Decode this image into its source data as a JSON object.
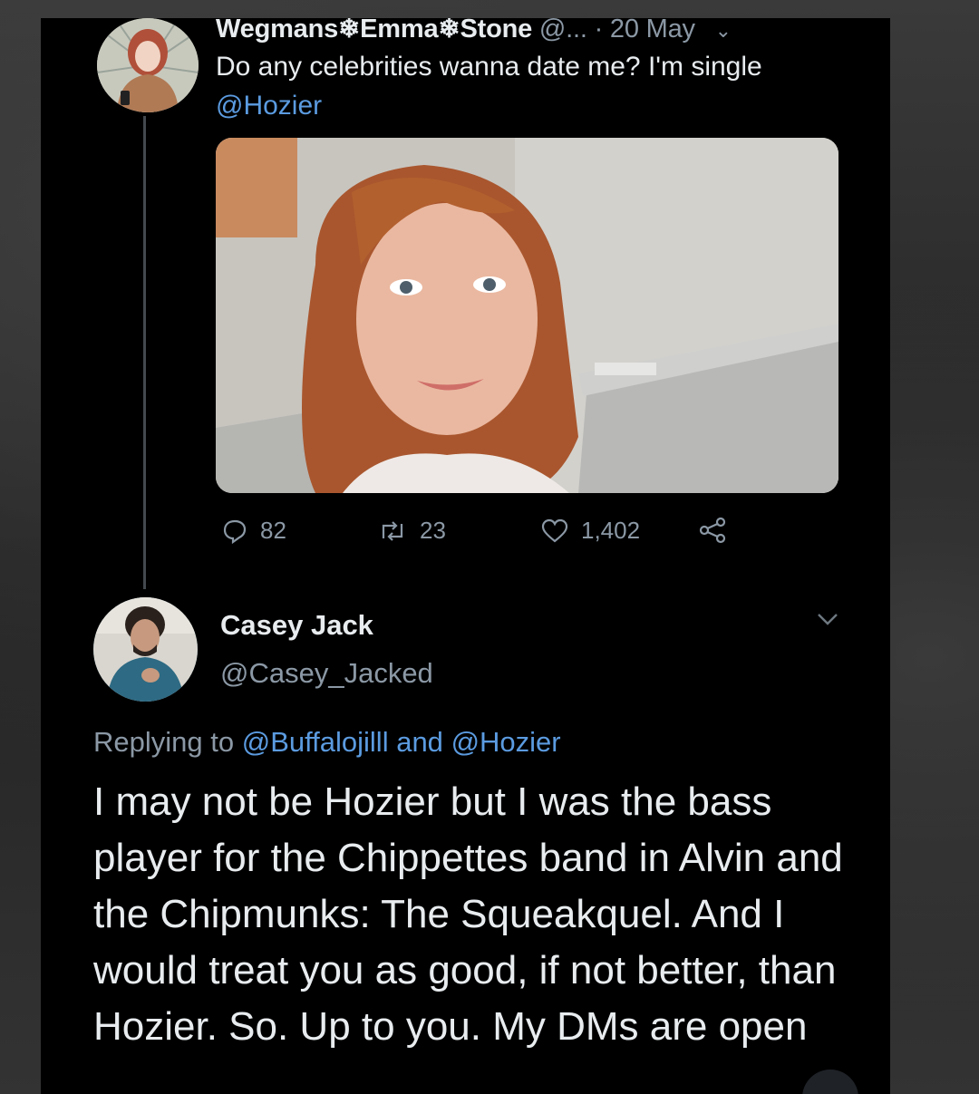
{
  "original_tweet": {
    "display_name": "Wegmans❄Emma❄Stone",
    "handle": "@...",
    "date": "· 20 May",
    "text": "Do any celebrities wanna date me? I'm single",
    "mention": "@Hozier",
    "stats": {
      "replies": "82",
      "retweets": "23",
      "likes": "1,402"
    }
  },
  "reply_tweet": {
    "display_name": "Casey Jack",
    "handle": "@Casey_Jacked",
    "replying_prefix": "Replying to",
    "replying_user1": "@Buffalojilll",
    "replying_and": "and",
    "replying_user2": "@Hozier",
    "text": "I may not be Hozier but I was the bass player for the Chippettes band in Alvin and the Chipmunks: The Squeakquel. And I would treat you as good, if not better, than Hozier. So. Up to you. My DMs are open"
  },
  "colors": {
    "background": "#000000",
    "text": "#e8ecef",
    "secondary": "#8b98a5",
    "link": "#5b9be0"
  },
  "icons": [
    "reply-icon",
    "retweet-icon",
    "like-icon",
    "share-icon",
    "chevron-down-icon"
  ]
}
